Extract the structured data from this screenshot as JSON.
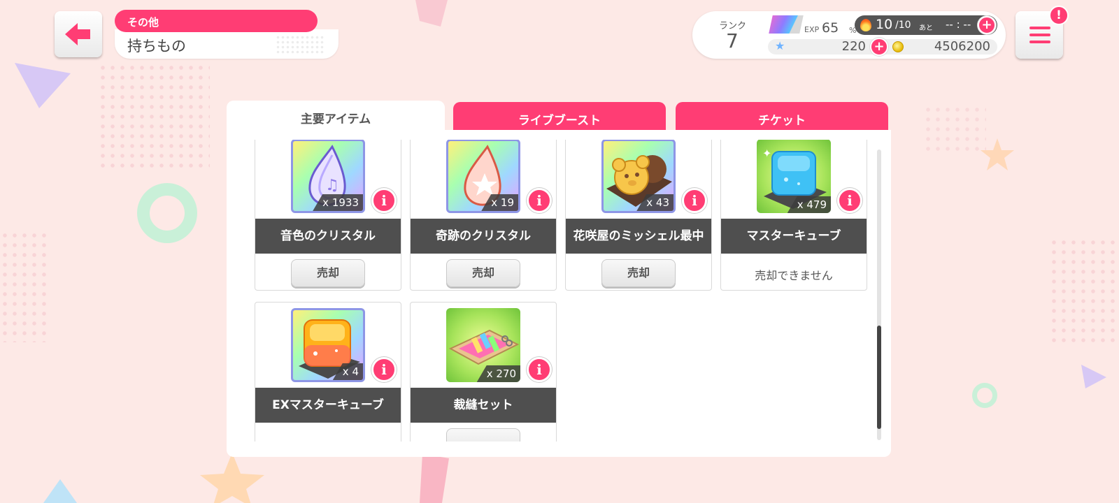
{
  "header": {
    "category": "その他",
    "title": "持ちもの"
  },
  "status": {
    "rank_label": "ランク",
    "rank_value": "7",
    "exp_label": "EXP",
    "exp_value": "65",
    "exp_percent_sign": "%",
    "exp_progress": 0.65,
    "stamina_current": "10",
    "stamina_max": "/10",
    "stamina_ato": "あと",
    "stamina_timer": "-- : --",
    "star_gems": "220",
    "coins": "4506200"
  },
  "menu": {
    "badge": "!"
  },
  "tabs": [
    {
      "label": "主要アイテム",
      "active": true
    },
    {
      "label": "ライブブースト",
      "active": false
    },
    {
      "label": "チケット",
      "active": false
    }
  ],
  "items": [
    {
      "name": "音色のクリスタル",
      "count": "x 1933",
      "sell_label": "売却",
      "info": "i"
    },
    {
      "name": "奇跡のクリスタル",
      "count": "x 19",
      "sell_label": "売却",
      "info": "i"
    },
    {
      "name": "花咲屋のミッシェル最中",
      "count": "x 43",
      "sell_label": "売却",
      "info": "i"
    },
    {
      "name": "マスターキューブ",
      "count": "x 479",
      "sell_label": "売却できません",
      "info": "i"
    },
    {
      "name": "EXマスターキューブ",
      "count": "x 4",
      "sell_label": "",
      "info": "i"
    },
    {
      "name": "裁縫セット",
      "count": "x 270",
      "sell_label": "",
      "info": "i"
    }
  ],
  "colors": {
    "accent": "#ff3d74",
    "background": "#fde9e6",
    "name_bar": "#4f4f4f"
  },
  "scroll_position": 0.62
}
